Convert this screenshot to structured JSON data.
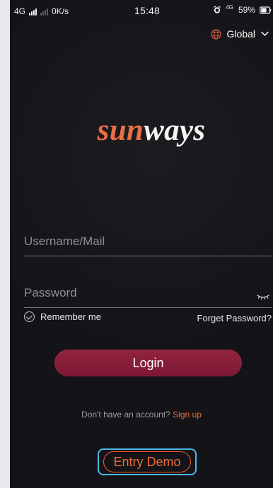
{
  "status_bar": {
    "network_left": "4G",
    "speed": "0K/s",
    "time": "15:48",
    "network_right": "4G",
    "battery": "59%"
  },
  "region": {
    "label": "Global"
  },
  "brand": {
    "logo_part1": "sun",
    "logo_part2": "ways",
    "accent_color": "#ea6b3f"
  },
  "form": {
    "username_placeholder": "Username/Mail",
    "password_placeholder": "Password",
    "remember_label": "Remember me",
    "forget_label": "Forget Password?",
    "login_label": "Login"
  },
  "footer": {
    "signup_prompt": "Don't have an account?",
    "signup_link": "Sign up",
    "demo_label": "Entry Demo"
  },
  "icons": {
    "signal": "signal-icon",
    "alarm": "alarm-icon",
    "battery": "battery-icon",
    "globe": "globe-icon",
    "chevron": "chevron-down-icon",
    "eye": "eye-closed-icon",
    "check": "check-circle-icon"
  }
}
